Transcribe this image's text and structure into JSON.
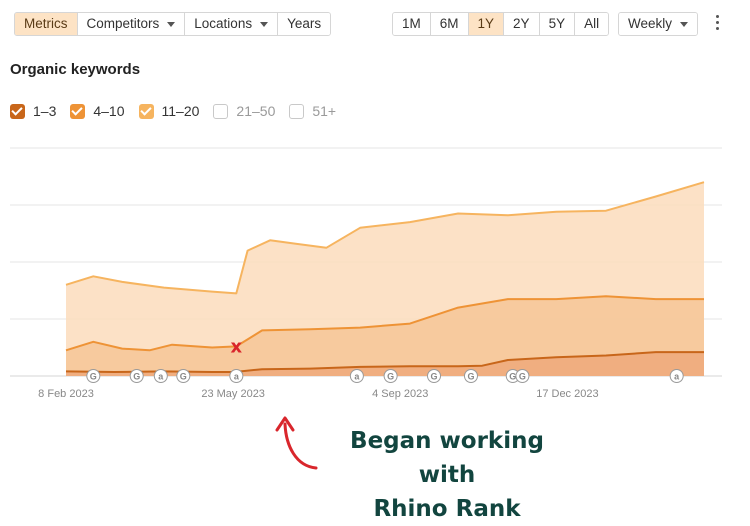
{
  "toolbar": {
    "tabs": [
      {
        "label": "Metrics",
        "active": true,
        "dropdown": false
      },
      {
        "label": "Competitors",
        "active": false,
        "dropdown": true
      },
      {
        "label": "Locations",
        "active": false,
        "dropdown": true
      },
      {
        "label": "Years",
        "active": false,
        "dropdown": false
      }
    ],
    "ranges": [
      {
        "label": "1M",
        "active": false
      },
      {
        "label": "6M",
        "active": false
      },
      {
        "label": "1Y",
        "active": true
      },
      {
        "label": "2Y",
        "active": false
      },
      {
        "label": "5Y",
        "active": false
      },
      {
        "label": "All",
        "active": false
      }
    ],
    "interval": "Weekly",
    "more_icon": "kebab-menu-icon"
  },
  "chart_data": {
    "type": "area",
    "title": "Organic keywords",
    "legend": [
      {
        "label": "1–3",
        "checked": true,
        "color": "#c8661a"
      },
      {
        "label": "4–10",
        "checked": true,
        "color": "#ee9336"
      },
      {
        "label": "11–20",
        "checked": true,
        "color": "#f6b45f"
      },
      {
        "label": "21–50",
        "checked": false,
        "color": "#c9c9c9"
      },
      {
        "label": "51+",
        "checked": false,
        "color": "#c9c9c9"
      }
    ],
    "x_tick_labels": [
      "8 Feb 2023",
      "23 May 2023",
      "4 Sep 2023",
      "17 Dec 2023"
    ],
    "x_ticks_dates": [
      "2023-02-08",
      "2023-05-23",
      "2023-09-04",
      "2023-12-17"
    ],
    "x_range": [
      "2023-02-08",
      "2024-03-11"
    ],
    "y_range": [
      0,
      4
    ],
    "y_gridlines": [
      0,
      1,
      2,
      3,
      4
    ],
    "y_axis_labels_shown": false,
    "series": [
      {
        "name": "1–3",
        "color": "#c8661a",
        "points": [
          [
            "2023-02-08",
            0.08
          ],
          [
            "2023-03-10",
            0.07
          ],
          [
            "2023-04-10",
            0.08
          ],
          [
            "2023-05-10",
            0.07
          ],
          [
            "2023-05-24",
            0.07
          ],
          [
            "2023-06-10",
            0.12
          ],
          [
            "2023-07-10",
            0.13
          ],
          [
            "2023-08-10",
            0.16
          ],
          [
            "2023-09-10",
            0.17
          ],
          [
            "2023-10-10",
            0.17
          ],
          [
            "2023-10-25",
            0.18
          ],
          [
            "2023-11-10",
            0.28
          ],
          [
            "2023-12-10",
            0.33
          ],
          [
            "2024-01-10",
            0.36
          ],
          [
            "2024-02-10",
            0.42
          ],
          [
            "2024-03-11",
            0.42
          ]
        ]
      },
      {
        "name": "4–10",
        "color": "#ee9336",
        "points": [
          [
            "2023-02-08",
            0.45
          ],
          [
            "2023-02-25",
            0.6
          ],
          [
            "2023-03-15",
            0.48
          ],
          [
            "2023-04-01",
            0.45
          ],
          [
            "2023-04-15",
            0.55
          ],
          [
            "2023-05-10",
            0.5
          ],
          [
            "2023-05-25",
            0.52
          ],
          [
            "2023-06-10",
            0.8
          ],
          [
            "2023-07-10",
            0.82
          ],
          [
            "2023-08-10",
            0.85
          ],
          [
            "2023-09-10",
            0.92
          ],
          [
            "2023-10-10",
            1.2
          ],
          [
            "2023-11-10",
            1.35
          ],
          [
            "2023-12-10",
            1.35
          ],
          [
            "2024-01-10",
            1.4
          ],
          [
            "2024-02-10",
            1.35
          ],
          [
            "2024-03-11",
            1.35
          ]
        ]
      },
      {
        "name": "11–20",
        "color": "#f6b45f",
        "points": [
          [
            "2023-02-08",
            1.6
          ],
          [
            "2023-02-25",
            1.75
          ],
          [
            "2023-03-15",
            1.65
          ],
          [
            "2023-04-10",
            1.55
          ],
          [
            "2023-05-10",
            1.48
          ],
          [
            "2023-05-25",
            1.45
          ],
          [
            "2023-06-01",
            2.2
          ],
          [
            "2023-06-15",
            2.38
          ],
          [
            "2023-07-01",
            2.32
          ],
          [
            "2023-07-20",
            2.25
          ],
          [
            "2023-08-10",
            2.6
          ],
          [
            "2023-09-10",
            2.7
          ],
          [
            "2023-10-10",
            2.85
          ],
          [
            "2023-11-10",
            2.82
          ],
          [
            "2023-12-10",
            2.88
          ],
          [
            "2024-01-10",
            2.9
          ],
          [
            "2024-02-10",
            3.15
          ],
          [
            "2024-03-11",
            3.4
          ]
        ]
      }
    ],
    "event_markers": [
      {
        "date": "2023-02-25",
        "label": "G"
      },
      {
        "date": "2023-03-24",
        "label": "G"
      },
      {
        "date": "2023-04-08",
        "label": "a"
      },
      {
        "date": "2023-04-22",
        "label": "G"
      },
      {
        "date": "2023-05-25",
        "label": "a"
      },
      {
        "date": "2023-08-08",
        "label": "a"
      },
      {
        "date": "2023-08-29",
        "label": "G"
      },
      {
        "date": "2023-09-25",
        "label": "G"
      },
      {
        "date": "2023-10-18",
        "label": "G"
      },
      {
        "date": "2023-11-13",
        "label": "G"
      },
      {
        "date": "2023-11-19",
        "label": "G"
      },
      {
        "date": "2024-02-23",
        "label": "a"
      }
    ],
    "x_marker": {
      "date": "2023-05-25",
      "value": 0.52,
      "label": "x"
    }
  },
  "annotation": {
    "line1": "Began working with",
    "line2": "Rhino Rank",
    "color": "#12453f",
    "arrow_color": "#d9262c"
  }
}
